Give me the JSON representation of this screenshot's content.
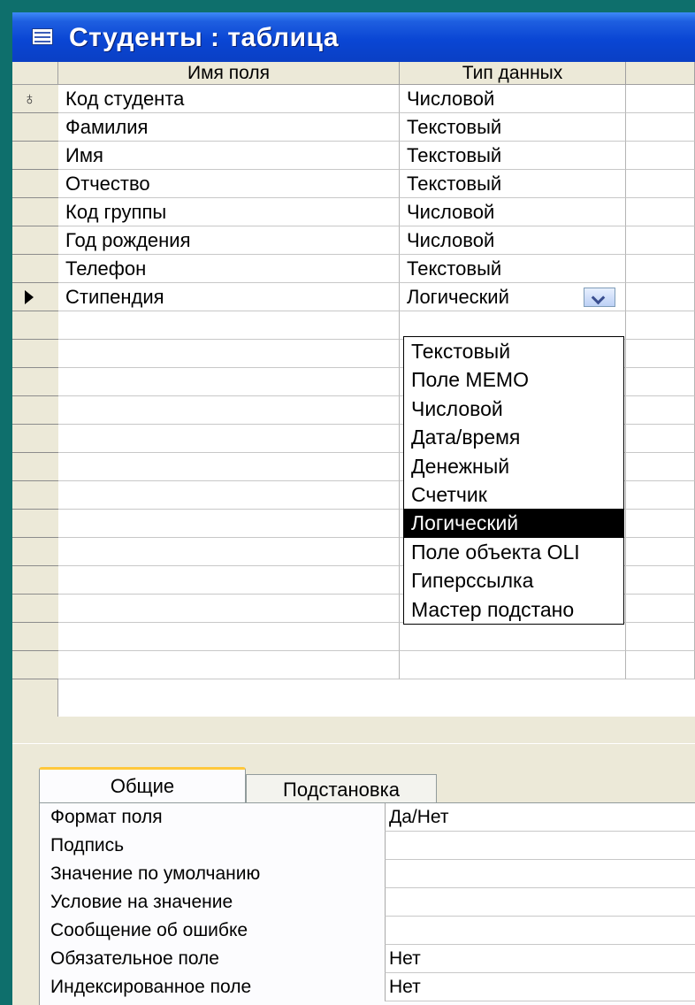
{
  "window": {
    "title": "Студенты : таблица"
  },
  "columns": {
    "field_name": "Имя поля",
    "data_type": "Тип данных"
  },
  "rows": [
    {
      "name": "Код студента",
      "type": "Числовой"
    },
    {
      "name": "Фамилия",
      "type": "Текстовый"
    },
    {
      "name": "Имя",
      "type": "Текстовый"
    },
    {
      "name": "Отчество",
      "type": "Текстовый"
    },
    {
      "name": "Код группы",
      "type": "Числовой"
    },
    {
      "name": "Год рождения",
      "type": "Числовой"
    },
    {
      "name": "Телефон",
      "type": "Текстовый"
    },
    {
      "name": "Стипендия",
      "type": "Логический"
    }
  ],
  "type_dropdown": {
    "options": [
      "Текстовый",
      "Поле МЕМО",
      "Числовой",
      "Дата/время",
      "Денежный",
      "Счетчик",
      "Логический",
      "Поле объекта OLI",
      "Гиперссылка",
      "Мастер подстано"
    ],
    "selected": "Логический"
  },
  "tabs": {
    "general": "Общие",
    "lookup": "Подстановка"
  },
  "properties": [
    {
      "label": "Формат поля",
      "value": "Да/Нет"
    },
    {
      "label": "Подпись",
      "value": ""
    },
    {
      "label": "Значение по умолчанию",
      "value": ""
    },
    {
      "label": "Условие на значение",
      "value": ""
    },
    {
      "label": "Сообщение об ошибке",
      "value": ""
    },
    {
      "label": "Обязательное поле",
      "value": "Нет"
    },
    {
      "label": "Индексированное поле",
      "value": "Нет"
    }
  ],
  "icons": {
    "primary_key": "key-icon",
    "current_row": "row-pointer-icon",
    "dropdown": "chevron-down-icon",
    "table": "table-icon"
  },
  "colors": {
    "desktop": "#0e6f6c",
    "titlebar": "#0a46d4",
    "window": "#ece9d8",
    "active_tab_accent": "#ffc83c"
  }
}
